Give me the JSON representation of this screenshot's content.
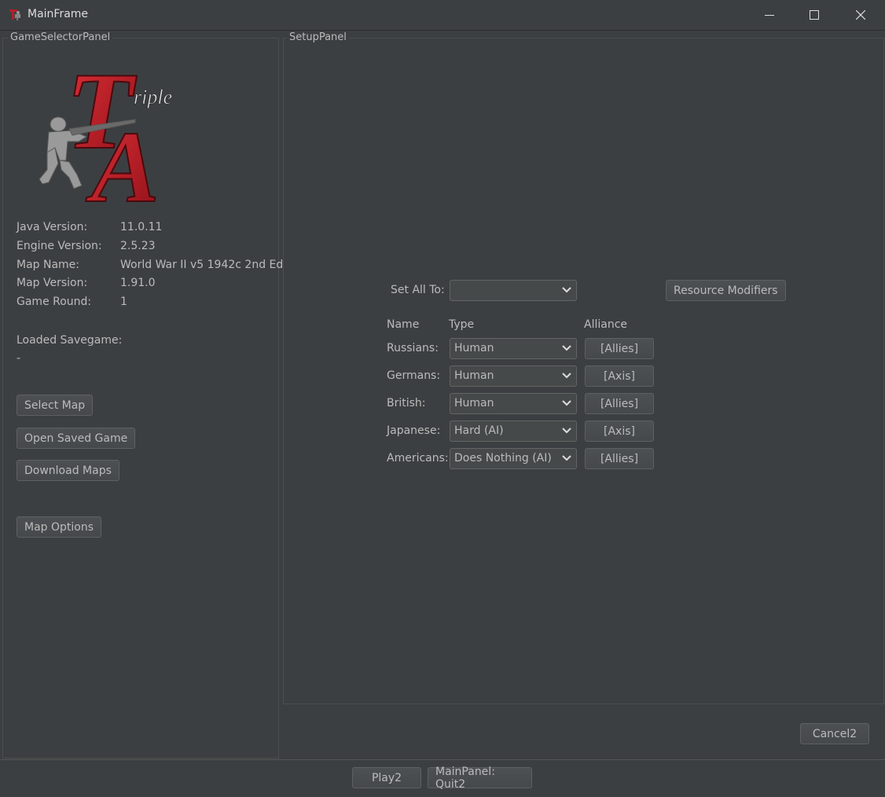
{
  "window": {
    "title": "MainFrame",
    "controls": [
      "minimize-icon",
      "maximize-icon",
      "close-icon"
    ]
  },
  "game_selector": {
    "panel_title": "GameSelectorPanel",
    "logo": {
      "text_big1": "T",
      "text_small": "riple",
      "text_big2": "A"
    },
    "info": [
      {
        "label": "Java Version:",
        "value": "11.0.11"
      },
      {
        "label": "Engine Version:",
        "value": "2.5.23"
      },
      {
        "label": "Map Name:",
        "value": "World War II v5 1942c 2nd Ed"
      },
      {
        "label": "Map Version:",
        "value": "1.91.0"
      },
      {
        "label": "Game Round:",
        "value": "1"
      }
    ],
    "loaded_savegame_label": "Loaded Savegame:",
    "loaded_savegame_value": "-",
    "buttons": {
      "select_map": "Select Map",
      "open_saved_game": "Open Saved Game",
      "download_maps": "Download Maps",
      "map_options": "Map Options"
    }
  },
  "setup": {
    "panel_title": "SetupPanel",
    "set_all_to_label": "Set All To:",
    "set_all_to_value": "",
    "resource_modifiers": "Resource Modifiers",
    "headers": {
      "name": "Name",
      "type": "Type",
      "alliance": "Alliance"
    },
    "players": [
      {
        "name": "Russians:",
        "type": "Human",
        "alliance": "[Allies]"
      },
      {
        "name": "Germans:",
        "type": "Human",
        "alliance": "[Axis]"
      },
      {
        "name": "British:",
        "type": "Human",
        "alliance": "[Allies]"
      },
      {
        "name": "Japanese:",
        "type": "Hard (AI)",
        "alliance": "[Axis]"
      },
      {
        "name": "Americans:",
        "type": "Does Nothing (AI)",
        "alliance": "[Allies]"
      }
    ],
    "cancel": "Cancel2"
  },
  "main": {
    "play": "Play2",
    "quit": "MainPanel: Quit2"
  }
}
